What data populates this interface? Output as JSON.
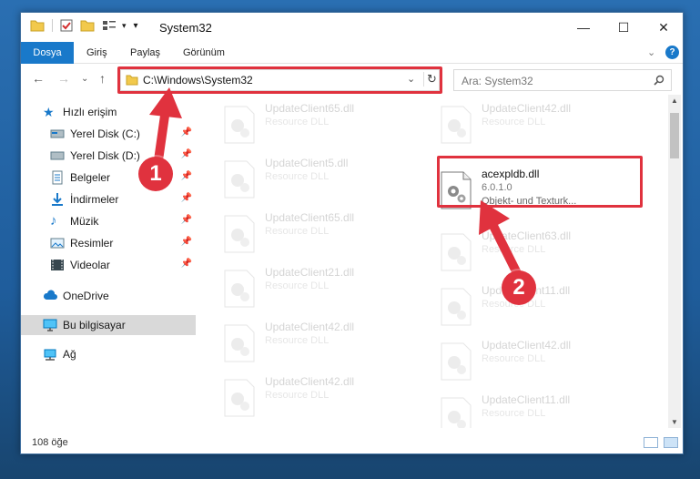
{
  "window": {
    "title": "System32",
    "minimize": "—",
    "maximize": "☐",
    "close": "✕"
  },
  "ribbon": {
    "tabs": [
      "Dosya",
      "Giriş",
      "Paylaş",
      "Görünüm"
    ]
  },
  "address": {
    "path": "C:\\Windows\\System32",
    "search_placeholder": "Ara: System32"
  },
  "nav": {
    "quick_access": "Hızlı erişim",
    "items": [
      {
        "label": "Yerel Disk (C:)",
        "icon": "drive-icon",
        "pinned": true
      },
      {
        "label": "Yerel Disk (D:)",
        "icon": "drive-icon",
        "pinned": true
      },
      {
        "label": "Belgeler",
        "icon": "documents-icon",
        "pinned": true
      },
      {
        "label": "İndirmeler",
        "icon": "downloads-icon",
        "pinned": true
      },
      {
        "label": "Müzik",
        "icon": "music-icon",
        "pinned": true
      },
      {
        "label": "Resimler",
        "icon": "pictures-icon",
        "pinned": true
      },
      {
        "label": "Videolar",
        "icon": "videos-icon",
        "pinned": true
      }
    ],
    "onedrive": "OneDrive",
    "this_pc": "Bu bilgisayar",
    "network": "Ağ"
  },
  "files": {
    "left": [
      {
        "name": "UpdateClient65.dll",
        "type": "Resource DLL"
      },
      {
        "name": "UpdateClient5.dll",
        "type": "Resource DLL"
      },
      {
        "name": "UpdateClient65.dll",
        "type": "Resource DLL"
      },
      {
        "name": "UpdateClient21.dll",
        "type": "Resource DLL"
      },
      {
        "name": "UpdateClient42.dll",
        "type": "Resource DLL"
      },
      {
        "name": "UpdateClient42.dll",
        "type": "Resource DLL"
      }
    ],
    "right": [
      {
        "name": "UpdateClient42.dll",
        "type": "Resource DLL"
      },
      {
        "name": "UpdateClient63.dll",
        "type": "Resource DLL"
      },
      {
        "name": "UpdateClient11.dll",
        "type": "Resource DLL"
      },
      {
        "name": "UpdateClient42.dll",
        "type": "Resource DLL"
      },
      {
        "name": "UpdateClient11.dll",
        "type": "Resource DLL"
      }
    ],
    "highlighted": {
      "name": "acexpldb.dll",
      "version": "6.0.1.0",
      "desc": "Objekt- und Texturk..."
    }
  },
  "status": {
    "count": "108 öğe"
  },
  "annotations": {
    "step1": "1",
    "step2": "2",
    "color": "#e0323e"
  }
}
